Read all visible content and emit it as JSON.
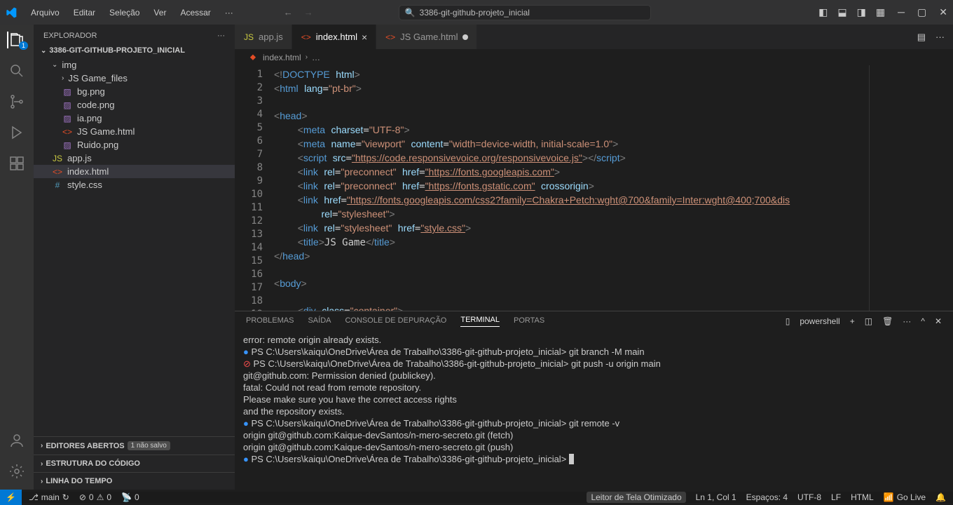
{
  "titlebar": {
    "menu": [
      "Arquivo",
      "Editar",
      "Seleção",
      "Ver",
      "Acessar"
    ],
    "search_label": "3386-git-github-projeto_inicial"
  },
  "sidebar": {
    "title": "EXPLORADOR",
    "root": "3386-GIT-GITHUB-PROJETO_INICIAL",
    "tree": [
      {
        "label": "img",
        "type": "folder",
        "depth": 1,
        "open": true
      },
      {
        "label": "JS Game_files",
        "type": "folder",
        "depth": 2,
        "open": false
      },
      {
        "label": "bg.png",
        "type": "img",
        "depth": 2
      },
      {
        "label": "code.png",
        "type": "img",
        "depth": 2
      },
      {
        "label": "ia.png",
        "type": "img",
        "depth": 2
      },
      {
        "label": "JS Game.html",
        "type": "html",
        "depth": 2
      },
      {
        "label": "Ruido.png",
        "type": "img",
        "depth": 2
      },
      {
        "label": "app.js",
        "type": "js",
        "depth": 1
      },
      {
        "label": "index.html",
        "type": "html",
        "depth": 1,
        "sel": true
      },
      {
        "label": "style.css",
        "type": "css",
        "depth": 1
      }
    ],
    "sections": {
      "editors": "EDITORES ABERTOS",
      "unsaved": "1 não salvo",
      "outline": "ESTRUTURA DO CÓDIGO",
      "timeline": "LINHA DO TEMPO"
    }
  },
  "tabs": [
    {
      "label": "app.js",
      "icon": "js"
    },
    {
      "label": "index.html",
      "icon": "html",
      "active": true,
      "close": true
    },
    {
      "label": "JS Game.html",
      "icon": "html",
      "dirty": true
    }
  ],
  "breadcrumb": {
    "file": "index.html"
  },
  "panel": {
    "tabs": [
      "PROBLEMAS",
      "SAÍDA",
      "CONSOLE DE DEPURAÇÃO",
      "TERMINAL",
      "PORTAS"
    ],
    "active": "TERMINAL",
    "shell": "powershell"
  },
  "terminal_lines": [
    {
      "marker": "",
      "text": "error: remote origin already exists."
    },
    {
      "marker": "blue",
      "text": "PS C:\\Users\\kaiqu\\OneDrive\\Área de Trabalho\\3386-git-github-projeto_inicial> git branch -M main"
    },
    {
      "marker": "red",
      "text": "PS C:\\Users\\kaiqu\\OneDrive\\Área de Trabalho\\3386-git-github-projeto_inicial> git push -u origin main"
    },
    {
      "marker": "",
      "text": "git@github.com: Permission denied (publickey)."
    },
    {
      "marker": "",
      "text": "fatal: Could not read from remote repository."
    },
    {
      "marker": "",
      "text": ""
    },
    {
      "marker": "",
      "text": "Please make sure you have the correct access rights"
    },
    {
      "marker": "",
      "text": "and the repository exists."
    },
    {
      "marker": "blue",
      "text": "PS C:\\Users\\kaiqu\\OneDrive\\Área de Trabalho\\3386-git-github-projeto_inicial> git remote -v"
    },
    {
      "marker": "",
      "text": "origin  git@github.com:Kaique-devSantos/n-mero-secreto.git (fetch)"
    },
    {
      "marker": "",
      "text": "origin  git@github.com:Kaique-devSantos/n-mero-secreto.git (push)"
    },
    {
      "marker": "blue",
      "text": "PS C:\\Users\\kaiqu\\OneDrive\\Área de Trabalho\\3386-git-github-projeto_inicial> ",
      "cursor": true
    }
  ],
  "status": {
    "branch": "main",
    "errors": "0",
    "warnings": "0",
    "ports": "0",
    "reader": "Leitor de Tela Otimizado",
    "ln_col": "Ln 1, Col 1",
    "spaces": "Espaços: 4",
    "encoding": "UTF-8",
    "eol": "LF",
    "lang": "HTML",
    "golive": "Go Live"
  },
  "code_lines": 18
}
